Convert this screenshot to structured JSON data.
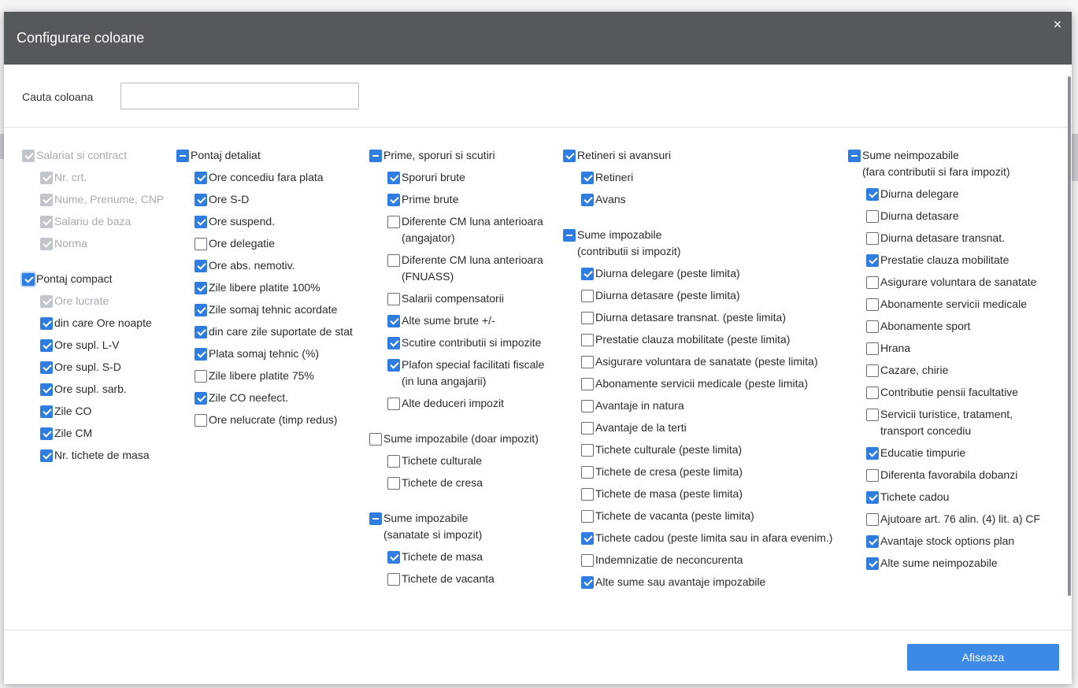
{
  "modal": {
    "title": "Configurare coloane",
    "close_glyph": "×",
    "search_label": "Cauta coloana",
    "search_value": "",
    "submit_label": "Afiseaza"
  },
  "columns": [
    {
      "groups": [
        {
          "label": "Salariat si contract",
          "state": "disabled-checked",
          "items": [
            {
              "label": "Nr. crt.",
              "state": "disabled-checked"
            },
            {
              "label": "Nume, Prenume, CNP",
              "state": "disabled-checked"
            },
            {
              "label": "Salariu de baza",
              "state": "disabled-checked"
            },
            {
              "label": "Norma",
              "state": "disabled-checked"
            }
          ]
        },
        {
          "label": "Pontaj compact",
          "state": "checked",
          "focused": true,
          "items": [
            {
              "label": "Ore lucrate",
              "state": "disabled-checked"
            },
            {
              "label": "din care Ore noapte",
              "state": "checked"
            },
            {
              "label": "Ore supl. L-V",
              "state": "checked"
            },
            {
              "label": "Ore supl. S-D",
              "state": "checked"
            },
            {
              "label": "Ore supl. sarb.",
              "state": "checked"
            },
            {
              "label": "Zile CO",
              "state": "checked"
            },
            {
              "label": "Zile CM",
              "state": "checked"
            },
            {
              "label": "Nr. tichete de masa",
              "state": "checked"
            }
          ]
        }
      ]
    },
    {
      "groups": [
        {
          "label": "Pontaj detaliat",
          "state": "indeterminate",
          "items": [
            {
              "label": "Ore concediu fara plata",
              "state": "checked"
            },
            {
              "label": "Ore S-D",
              "state": "checked"
            },
            {
              "label": "Ore suspend.",
              "state": "checked"
            },
            {
              "label": "Ore delegatie",
              "state": "unchecked"
            },
            {
              "label": "Ore abs. nemotiv.",
              "state": "checked"
            },
            {
              "label": "Zile libere platite 100%",
              "state": "checked"
            },
            {
              "label": "Zile somaj tehnic acordate",
              "state": "checked"
            },
            {
              "label": "din care zile suportate de stat",
              "state": "checked"
            },
            {
              "label": "Plata somaj tehnic (%)",
              "state": "checked"
            },
            {
              "label": "Zile libere platite 75%",
              "state": "unchecked"
            },
            {
              "label": "Zile CO neefect.",
              "state": "checked"
            },
            {
              "label": "Ore nelucrate (timp redus)",
              "state": "unchecked"
            }
          ]
        }
      ]
    },
    {
      "groups": [
        {
          "label": "Prime, sporuri si scutiri",
          "state": "indeterminate",
          "items": [
            {
              "label": "Sporuri brute",
              "state": "checked"
            },
            {
              "label": "Prime brute",
              "state": "checked"
            },
            {
              "label": "Diferente CM luna anterioara",
              "label2": "(angajator)",
              "state": "unchecked"
            },
            {
              "label": "Diferente CM luna anterioara",
              "label2": "(FNUASS)",
              "state": "unchecked"
            },
            {
              "label": "Salarii compensatorii",
              "state": "unchecked"
            },
            {
              "label": "Alte sume brute +/-",
              "state": "checked"
            },
            {
              "label": "Scutire contributii si impozite",
              "state": "checked"
            },
            {
              "label": "Plafon special facilitati fiscale",
              "label2": "(in luna angajarii)",
              "state": "checked"
            },
            {
              "label": "Alte deduceri impozit",
              "state": "unchecked"
            }
          ]
        },
        {
          "label": "Sume impozabile (doar impozit)",
          "state": "unchecked",
          "items": [
            {
              "label": "Tichete culturale",
              "state": "unchecked"
            },
            {
              "label": "Tichete de cresa",
              "state": "unchecked"
            }
          ]
        },
        {
          "label": "Sume impozabile",
          "label2": "(sanatate si impozit)",
          "state": "indeterminate",
          "items": [
            {
              "label": "Tichete de masa",
              "state": "checked"
            },
            {
              "label": "Tichete de vacanta",
              "state": "unchecked"
            }
          ]
        }
      ]
    },
    {
      "groups": [
        {
          "label": "Retineri si avansuri",
          "state": "checked",
          "items": [
            {
              "label": "Retineri",
              "state": "checked"
            },
            {
              "label": "Avans",
              "state": "checked"
            }
          ]
        },
        {
          "label": "Sume impozabile",
          "label2": "(contributii si impozit)",
          "state": "indeterminate",
          "items": [
            {
              "label": "Diurna delegare (peste limita)",
              "state": "checked"
            },
            {
              "label": "Diurna detasare (peste limita)",
              "state": "unchecked"
            },
            {
              "label": "Diurna detasare transnat. (peste limita)",
              "state": "unchecked"
            },
            {
              "label": "Prestatie clauza mobilitate (peste limita)",
              "state": "unchecked"
            },
            {
              "label": "Asigurare voluntara de sanatate (peste limita)",
              "state": "unchecked"
            },
            {
              "label": "Abonamente servicii medicale (peste limita)",
              "state": "unchecked"
            },
            {
              "label": "Avantaje in natura",
              "state": "unchecked"
            },
            {
              "label": "Avantaje de la terti",
              "state": "unchecked"
            },
            {
              "label": "Tichete culturale (peste limita)",
              "state": "unchecked"
            },
            {
              "label": "Tichete de cresa (peste limita)",
              "state": "unchecked"
            },
            {
              "label": "Tichete de masa (peste limita)",
              "state": "unchecked"
            },
            {
              "label": "Tichete de vacanta (peste limita)",
              "state": "unchecked"
            },
            {
              "label": "Tichete cadou (peste limita sau in afara evenim.)",
              "state": "checked"
            },
            {
              "label": "Indemnizatie de neconcurenta",
              "state": "unchecked"
            },
            {
              "label": "Alte sume sau avantaje impozabile",
              "state": "checked"
            }
          ]
        }
      ]
    },
    {
      "groups": [
        {
          "label": "Sume neimpozabile",
          "label2": "(fara contributii si fara impozit)",
          "state": "indeterminate",
          "items": [
            {
              "label": "Diurna delegare",
              "state": "checked"
            },
            {
              "label": "Diurna detasare",
              "state": "unchecked"
            },
            {
              "label": "Diurna detasare transnat.",
              "state": "unchecked"
            },
            {
              "label": "Prestatie clauza mobilitate",
              "state": "checked"
            },
            {
              "label": "Asigurare voluntara de sanatate",
              "state": "unchecked"
            },
            {
              "label": "Abonamente servicii medicale",
              "state": "unchecked"
            },
            {
              "label": "Abonamente sport",
              "state": "unchecked"
            },
            {
              "label": "Hrana",
              "state": "unchecked"
            },
            {
              "label": "Cazare, chirie",
              "state": "unchecked"
            },
            {
              "label": "Contributie pensii facultative",
              "state": "unchecked"
            },
            {
              "label": "Servicii turistice, tratament,",
              "label2": "transport concediu",
              "state": "unchecked"
            },
            {
              "label": "Educatie timpurie",
              "state": "checked"
            },
            {
              "label": "Diferenta favorabila dobanzi",
              "state": "unchecked"
            },
            {
              "label": "Tichete cadou",
              "state": "checked"
            },
            {
              "label": "Ajutoare art. 76 alin. (4) lit. a) CF",
              "state": "unchecked"
            },
            {
              "label": "Avantaje stock options plan",
              "state": "checked"
            },
            {
              "label": "Alte sume neimpozabile",
              "state": "checked"
            }
          ]
        }
      ]
    }
  ]
}
